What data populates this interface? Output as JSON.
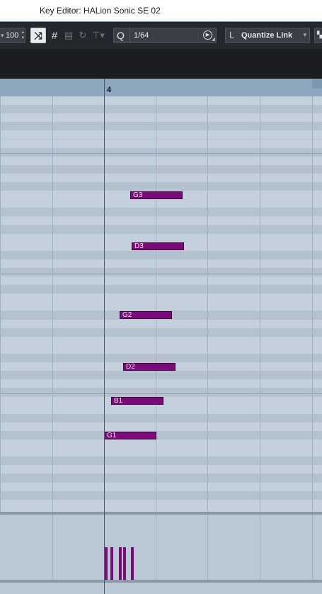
{
  "window": {
    "title": "Key Editor: HALion Sonic SE 02"
  },
  "toolbar": {
    "velocity_value": "100",
    "grid_icon_label": "#",
    "quantize_icon_label": "Q",
    "quantize_value": "1/64",
    "quantize_link_icon_label": "L",
    "quantize_link_label": "Quantize Link"
  },
  "ruler": {
    "bar_number": "4"
  },
  "notes": [
    {
      "label": "G3"
    },
    {
      "label": "D3"
    },
    {
      "label": "G2"
    },
    {
      "label": "D2"
    },
    {
      "label": "B1"
    },
    {
      "label": "G1"
    }
  ],
  "colors": {
    "note_fill": "#7d0a7a",
    "grid_light": "#c4d0dc",
    "grid_dark": "#b4c2cf",
    "ruler": "#8ea7be",
    "toolbar": "#24282c"
  }
}
